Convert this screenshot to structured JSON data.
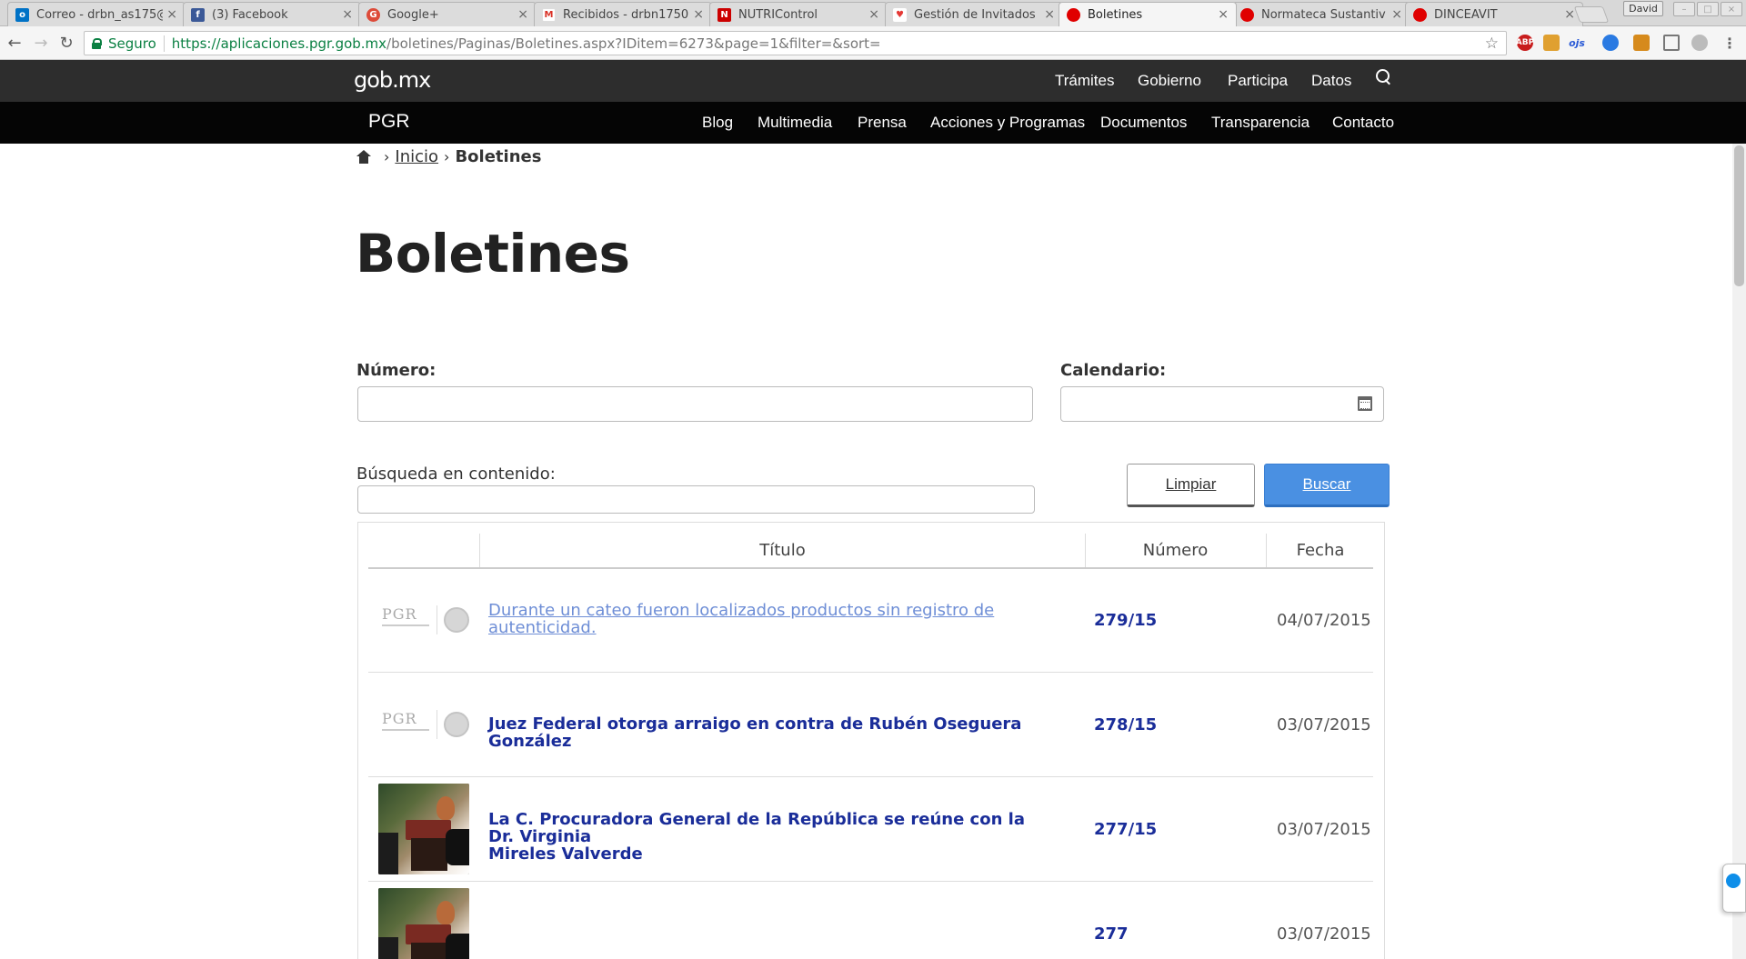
{
  "browser": {
    "tabs": [
      {
        "title": "Correo - drbn_as175@",
        "favicon": "outlook-icon",
        "color": "#0072c6"
      },
      {
        "title": "(3) Facebook",
        "favicon": "facebook-icon",
        "color": "#3b5998"
      },
      {
        "title": "Google+",
        "favicon": "googleplus-icon",
        "color": "#dd4b39"
      },
      {
        "title": "Recibidos - drbn1750@",
        "favicon": "gmail-icon",
        "color": "#d93025"
      },
      {
        "title": "NUTRIControl",
        "favicon": "nutricontrol-icon",
        "color": "#cc0000"
      },
      {
        "title": "Gestión de Invitados",
        "favicon": "heart-icon",
        "color": "#e53935"
      },
      {
        "title": "Boletines",
        "favicon": "pgr-icon",
        "color": "#e00000",
        "active": true
      },
      {
        "title": "Normateca Sustantiv",
        "favicon": "pgr-icon",
        "color": "#e00000"
      },
      {
        "title": "DINCEAVIT",
        "favicon": "pgr-icon",
        "color": "#e00000"
      }
    ],
    "user_badge": "David",
    "secure_label": "Seguro",
    "url_origin": "https://aplicaciones.pgr.gob.mx",
    "url_path": "/boletines/Paginas/Boletines.aspx?IDitem=6273&page=1&filter=&sort=",
    "extensions": [
      {
        "label": "ABP",
        "color": "#c81d1d"
      },
      {
        "label": "",
        "color": "#e0a030"
      },
      {
        "label": "ojs",
        "color": "#ffffff"
      },
      {
        "label": "",
        "color": "#2a7ae2"
      },
      {
        "label": "",
        "color": "#d68a1c"
      },
      {
        "label": "",
        "color": "#999999"
      },
      {
        "label": "",
        "color": "#bbbbbb"
      }
    ]
  },
  "gob": {
    "logo": "gob.mx",
    "nav": [
      "Trámites",
      "Gobierno",
      "Participa",
      "Datos"
    ]
  },
  "pgr": {
    "title": "PGR",
    "nav": [
      "Blog",
      "Multimedia",
      "Prensa",
      "Acciones y Programas",
      "Documentos",
      "Transparencia",
      "Contacto"
    ]
  },
  "breadcrumb": {
    "inicio": "Inicio",
    "current": "Boletines"
  },
  "page": {
    "title": "Boletines"
  },
  "form": {
    "numero_label": "Número:",
    "calendario_label": "Calendario:",
    "busqueda_label": "Búsqueda en contenido:",
    "limpiar_label": "Limpiar",
    "buscar_label": "Buscar"
  },
  "table": {
    "headers": [
      "Título",
      "Número",
      "Fecha"
    ],
    "rows": [
      {
        "thumb": "pgr-logo",
        "title_line1": "Durante un cateo fueron localizados productos sin registro de",
        "title_line2": "autenticidad.",
        "numero": "279/15",
        "fecha": "04/07/2015",
        "visited": true
      },
      {
        "thumb": "pgr-logo",
        "title_line1": "Juez Federal otorga arraigo en contra de Rubén Oseguera González",
        "title_line2": "",
        "numero": "278/15",
        "fecha": "03/07/2015",
        "visited": false
      },
      {
        "thumb": "photo",
        "title_line1": "La C. Procuradora General de la República se reúne con la Dr. Virginia",
        "title_line2": "Mireles Valverde",
        "numero": "277/15",
        "fecha": "03/07/2015",
        "visited": false
      },
      {
        "thumb": "photo",
        "title_line1": "",
        "title_line2": "",
        "numero": "277",
        "fecha": "03/07/2015",
        "visited": false
      }
    ]
  }
}
